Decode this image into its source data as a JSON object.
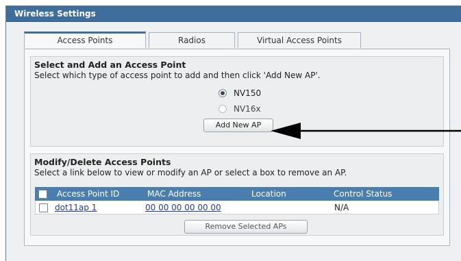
{
  "window": {
    "title": "Wireless Settings"
  },
  "tabs": [
    {
      "label": "Access Points",
      "active": true
    },
    {
      "label": "Radios",
      "active": false
    },
    {
      "label": "Virtual Access Points",
      "active": false
    }
  ],
  "select_add": {
    "title": "Select and Add an Access Point",
    "description": "Select which type of access point to add and then click 'Add New AP'.",
    "options": [
      {
        "label": "NV150",
        "selected": true
      },
      {
        "label": "NV16x",
        "selected": false
      }
    ],
    "add_button": "Add New AP"
  },
  "modify_delete": {
    "title": "Modify/Delete Access Points",
    "description": "Select a link below to view or modify an AP or select a box to remove an AP.",
    "columns": [
      "Access Point ID",
      "MAC Address",
      "Location",
      "Control Status"
    ],
    "rows": [
      {
        "access_point_id": "dot11ap 1",
        "mac_address": "00 00 00 00 00 00",
        "location": "",
        "control_status": "N/A"
      }
    ],
    "remove_button": "Remove Selected APs"
  },
  "colors": {
    "title_bar": "#3f6e9c",
    "grid_header": "#4a7eae",
    "link": "#1f3f9e"
  }
}
